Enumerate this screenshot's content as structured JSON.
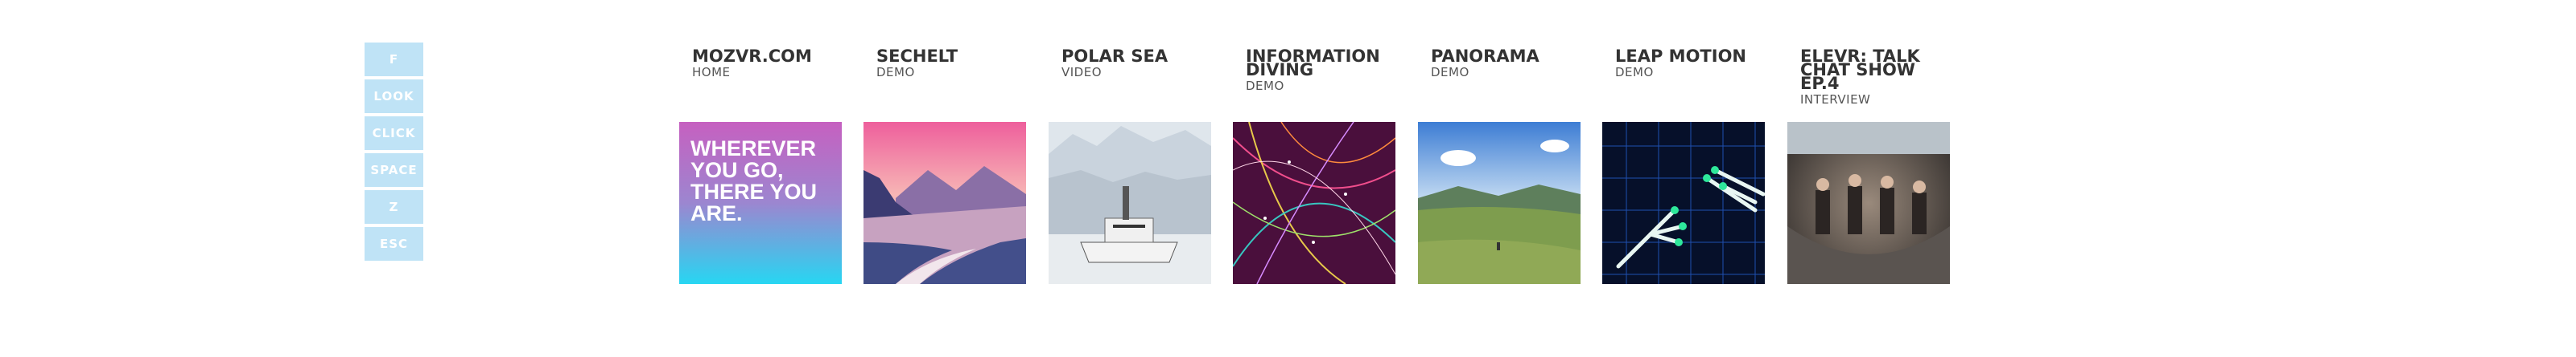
{
  "keyboard_shortcuts": [
    "F",
    "LOOK",
    "CLICK",
    "SPACE",
    "Z",
    "ESC"
  ],
  "tiles": [
    {
      "title": "MOZVR.COM",
      "subtitle": "HOME",
      "thumb_text": "WHEREVER YOU GO, THERE YOU ARE."
    },
    {
      "title": "SECHELT",
      "subtitle": "DEMO"
    },
    {
      "title": "POLAR SEA",
      "subtitle": "VIDEO"
    },
    {
      "title": "INFORMATION DIVING",
      "subtitle": "DEMO"
    },
    {
      "title": "PANORAMA",
      "subtitle": "DEMO"
    },
    {
      "title": "LEAP MOTION",
      "subtitle": "DEMO"
    },
    {
      "title": "ELEVR: TALK CHAT SHOW EP.4",
      "subtitle": "INTERVIEW"
    }
  ],
  "colors": {
    "key_bg": "#bfe3f6",
    "title_text": "#333333",
    "subtitle_text": "#555555"
  }
}
